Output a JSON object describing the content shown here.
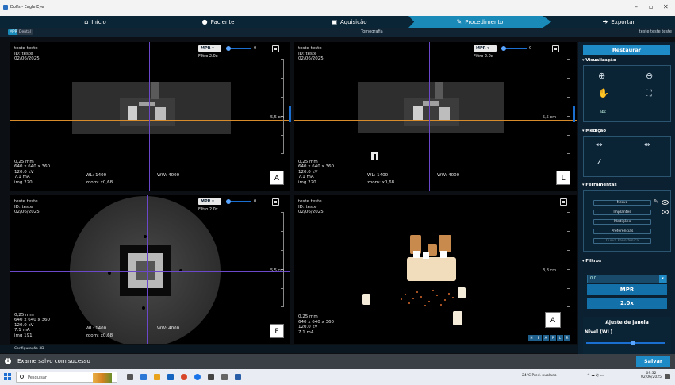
{
  "window": {
    "title": "Dolfs - Eagle Eye"
  },
  "nav": {
    "items": [
      {
        "label": "Início",
        "icon": "home-icon"
      },
      {
        "label": "Paciente",
        "icon": "person-icon"
      },
      {
        "label": "Aquisição",
        "icon": "camera-icon"
      },
      {
        "label": "Procedimento",
        "icon": "edit-icon"
      },
      {
        "label": "Exportar",
        "icon": "export-icon"
      }
    ],
    "active": "Procedimento"
  },
  "subbar": {
    "tab1": "MPR",
    "tab2": "Dental",
    "center": "Tomografia",
    "right": "teste teste teste"
  },
  "viewports": [
    {
      "id": "A",
      "name": "teste teste",
      "pid": "ID: teste",
      "date": "02/06/2025",
      "mode": "MPR",
      "slider": "0",
      "filter": "Filtro 2.0x",
      "scale": "5,5 cm",
      "line1": "0,25 mm",
      "line2": "640 x 640 x 360",
      "line3": "120.0 kV",
      "line4": "7.1 mA",
      "img": "img 220",
      "wl": "WL: 1400",
      "ww": "WW: 4000",
      "zoom": "zoom: x0,68"
    },
    {
      "id": "L",
      "name": "teste teste",
      "pid": "ID: teste",
      "date": "02/06/2025",
      "mode": "MPR",
      "slider": "0",
      "filter": "Filtro 2.0x",
      "scale": "5,5 cm",
      "line1": "0,25 mm",
      "line2": "640 x 640 x 360",
      "line3": "120.0 kV",
      "line4": "7.1 mA",
      "img": "img 220",
      "wl": "WL: 1400",
      "ww": "WW: 4000",
      "zoom": "zoom: x0,68"
    },
    {
      "id": "F",
      "name": "teste teste",
      "pid": "ID: teste",
      "date": "02/06/2025",
      "mode": "MPR",
      "slider": "0",
      "filter": "Filtro 2.0x",
      "scale": "5,5 cm",
      "line1": "0,25 mm",
      "line2": "640 x 640 x 360",
      "line3": "120.0 kV",
      "line4": "7.1 mA",
      "img": "img 191",
      "wl": "WL: 1400",
      "ww": "WW: 4000",
      "zoom": "zoom: x0,68"
    },
    {
      "id": "A",
      "name": "teste teste",
      "pid": "ID: teste",
      "date": "02/06/2025",
      "scale": "3,8 cm",
      "line1": "0,25 mm",
      "line2": "640 x 640 x 360",
      "line3": "120.0 kV",
      "line4": "7.1 mA",
      "cube_buttons": [
        "H",
        "E",
        "A",
        "P",
        "L",
        "R"
      ]
    }
  ],
  "panel": {
    "restaurar": "Restaurar",
    "visualizacao": "Visualização",
    "medicao": "Medição",
    "ferramentas": "Ferramentas",
    "ferramentas_items": [
      "Nervo",
      "Implantes",
      "Medições",
      "Preferências",
      "Curva Panorâmica"
    ],
    "filtros": "Filtros",
    "filter_value": "0.0",
    "mpr_button": "MPR",
    "zoom_button": "2.0x",
    "ajuste": "Ajuste de janela",
    "nivel": "Nível (WL)",
    "misc": "abc"
  },
  "config": "Configuração 3D",
  "toast": {
    "message": "Exame salvo com sucesso",
    "save": "Salvar"
  },
  "taskbar": {
    "search": "Pesquisar",
    "weather": "24°C  Pred. nublado",
    "time": "09:32",
    "date": "02/06/2025"
  },
  "colors": {
    "accent": "#1e8ac6",
    "nav_bg": "#0a2536",
    "crosshair_h": "#d88b2b",
    "crosshair_v": "#6b48c9"
  }
}
